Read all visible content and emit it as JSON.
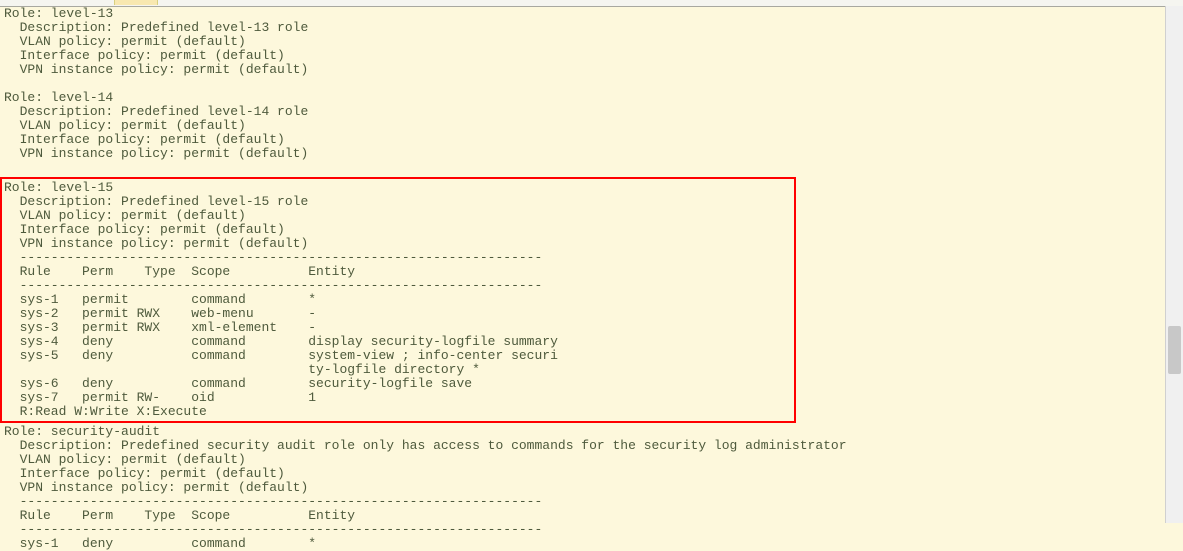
{
  "roles": [
    {
      "name": "level-13",
      "description": "Predefined level-13 role",
      "vlan_policy": "permit (default)",
      "interface_policy": "permit (default)",
      "vpn_instance_policy": "permit (default)",
      "highlight": false,
      "rules": null,
      "rules_legend": null
    },
    {
      "name": "level-14",
      "description": "Predefined level-14 role",
      "vlan_policy": "permit (default)",
      "interface_policy": "permit (default)",
      "vpn_instance_policy": "permit (default)",
      "highlight": false,
      "rules": null,
      "rules_legend": null
    },
    {
      "name": "level-15",
      "description": "Predefined level-15 role",
      "vlan_policy": "permit (default)",
      "interface_policy": "permit (default)",
      "vpn_instance_policy": "permit (default)",
      "highlight": true,
      "rules": {
        "headers": {
          "rule": "Rule",
          "perm": "Perm",
          "type": "Type",
          "scope": "Scope",
          "entity": "Entity"
        },
        "rows": [
          {
            "rule": "sys-1",
            "perm": "permit",
            "type": "",
            "scope": "command",
            "entity": "*"
          },
          {
            "rule": "sys-2",
            "perm": "permit",
            "type": "RWX",
            "scope": "web-menu",
            "entity": "-"
          },
          {
            "rule": "sys-3",
            "perm": "permit",
            "type": "RWX",
            "scope": "xml-element",
            "entity": "-"
          },
          {
            "rule": "sys-4",
            "perm": "deny",
            "type": "",
            "scope": "command",
            "entity": "display security-logfile summary"
          },
          {
            "rule": "sys-5",
            "perm": "deny",
            "type": "",
            "scope": "command",
            "entity": "system-view ; info-center securi",
            "entity_cont": "ty-logfile directory *"
          },
          {
            "rule": "sys-6",
            "perm": "deny",
            "type": "",
            "scope": "command",
            "entity": "security-logfile save"
          },
          {
            "rule": "sys-7",
            "perm": "permit",
            "type": "RW-",
            "scope": "oid",
            "entity": "1"
          }
        ]
      },
      "rules_legend": "R:Read W:Write X:Execute"
    },
    {
      "name": "security-audit",
      "description": "Predefined security audit role only has access to commands for the security log administrator",
      "vlan_policy": "permit (default)",
      "interface_policy": "permit (default)",
      "vpn_instance_policy": "permit (default)",
      "highlight": false,
      "rules": {
        "headers": {
          "rule": "Rule",
          "perm": "Perm",
          "type": "Type",
          "scope": "Scope",
          "entity": "Entity"
        },
        "rows": [
          {
            "rule": "sys-1",
            "perm": "deny",
            "type": "",
            "scope": "command",
            "entity": "*"
          }
        ]
      },
      "rules_legend": null
    }
  ],
  "labels": {
    "role": "Role",
    "description": "Description",
    "vlan_policy": "VLAN policy",
    "interface_policy": "Interface policy",
    "vpn_instance_policy": "VPN instance policy"
  },
  "separator": "-------------------------------------------------------------------"
}
